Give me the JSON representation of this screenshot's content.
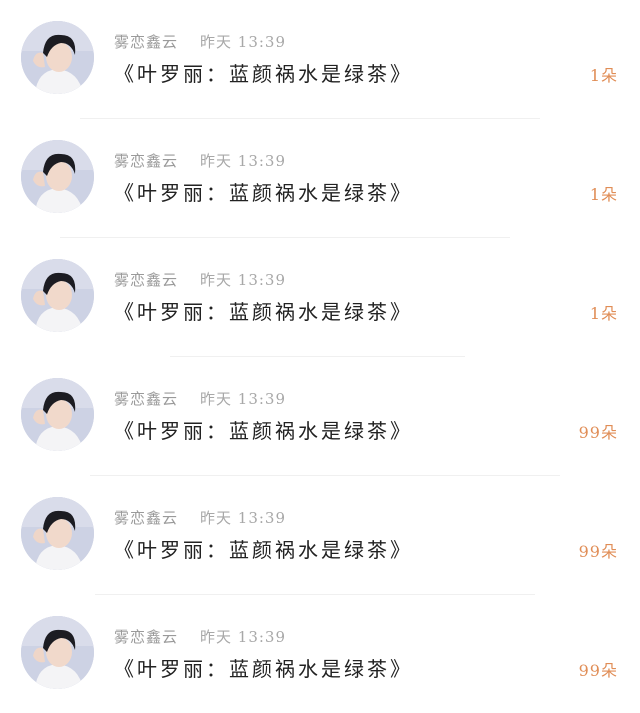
{
  "comments": [
    {
      "user": "雾恋鑫云",
      "time": "昨天 13:39",
      "text": "《叶罗丽：蓝颜祸水是绿茶》",
      "gift": "1朵"
    },
    {
      "user": "雾恋鑫云",
      "time": "昨天 13:39",
      "text": "《叶罗丽：蓝颜祸水是绿茶》",
      "gift": "1朵"
    },
    {
      "user": "雾恋鑫云",
      "time": "昨天 13:39",
      "text": "《叶罗丽：蓝颜祸水是绿茶》",
      "gift": "1朵"
    },
    {
      "user": "雾恋鑫云",
      "time": "昨天 13:39",
      "text": "《叶罗丽：蓝颜祸水是绿茶》",
      "gift": "99朵"
    },
    {
      "user": "雾恋鑫云",
      "time": "昨天 13:39",
      "text": "《叶罗丽：蓝颜祸水是绿茶》",
      "gift": "99朵"
    },
    {
      "user": "雾恋鑫云",
      "time": "昨天 13:39",
      "text": "《叶罗丽：蓝颜祸水是绿茶》",
      "gift": "99朵"
    }
  ],
  "colors": {
    "gift_accent": "#e08d56",
    "meta_gray": "#a5a5a5",
    "text_dark": "#222222"
  }
}
